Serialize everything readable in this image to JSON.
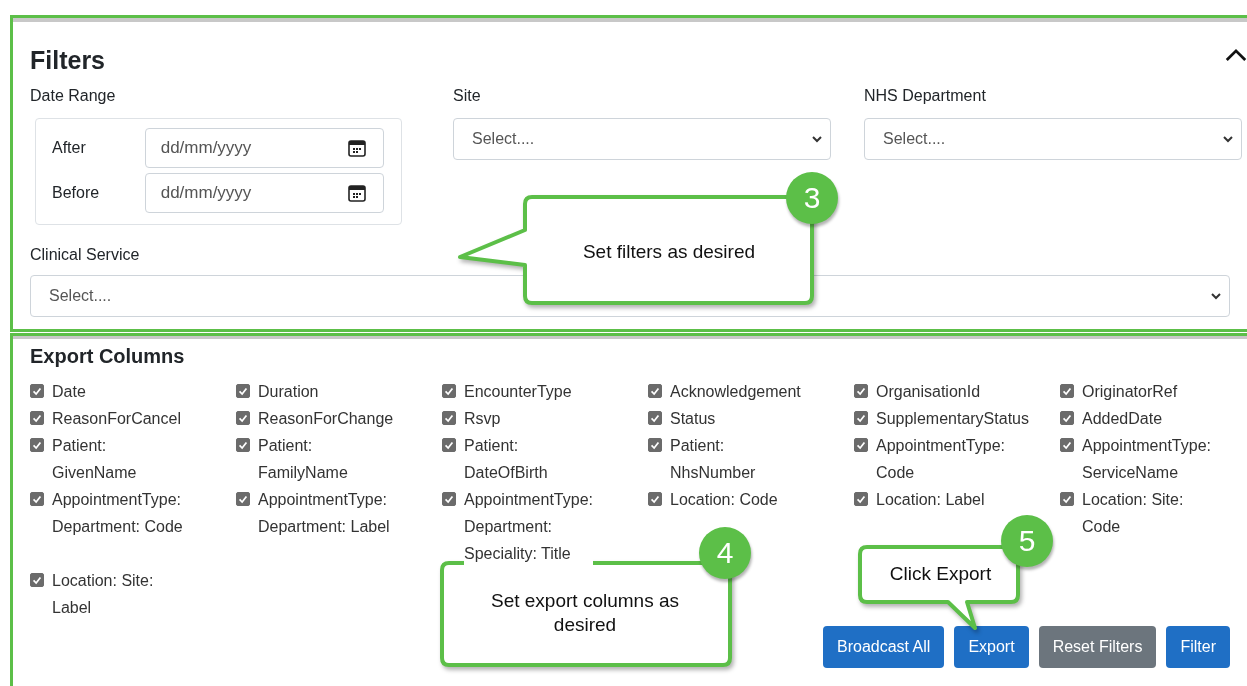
{
  "filters": {
    "title": "Filters",
    "highlighted": true,
    "date_range": {
      "label": "Date Range",
      "rows": [
        {
          "label": "After",
          "placeholder": "dd/mm/yyyy"
        },
        {
          "label": "Before",
          "placeholder": "dd/mm/yyyy"
        }
      ]
    },
    "selects": [
      {
        "label": "Site",
        "placeholder": "Select...."
      },
      {
        "label": "NHS Department",
        "placeholder": "Select...."
      },
      {
        "label": "Clinical Service",
        "placeholder": "Select...."
      }
    ]
  },
  "export_columns": {
    "title": "Export Columns",
    "highlighted": true,
    "columns": [
      {
        "label": "Date",
        "checked": true
      },
      {
        "label": "Duration",
        "checked": true
      },
      {
        "label": "EncounterType",
        "checked": true
      },
      {
        "label": "Acknowledgement",
        "checked": true
      },
      {
        "label": "OrganisationId",
        "checked": true
      },
      {
        "label": "OriginatorRef",
        "checked": true
      },
      {
        "label": "ReasonForCancel",
        "checked": true
      },
      {
        "label": "ReasonForChange",
        "checked": true
      },
      {
        "label": "Rsvp",
        "checked": true
      },
      {
        "label": "Status",
        "checked": true
      },
      {
        "label": "SupplementaryStatus",
        "checked": true
      },
      {
        "label": "AddedDate",
        "checked": true
      },
      {
        "label": "Patient:\nGivenName",
        "checked": true
      },
      {
        "label": "Patient:\nFamilyName",
        "checked": true
      },
      {
        "label": "Patient:\nDateOfBirth",
        "checked": true
      },
      {
        "label": "Patient:\nNhsNumber",
        "checked": true
      },
      {
        "label": "AppointmentType:\nCode",
        "checked": true
      },
      {
        "label": "AppointmentType:\nServiceName",
        "checked": true
      },
      {
        "label": "AppointmentType:\nDepartment: Code",
        "checked": true
      },
      {
        "label": "AppointmentType:\nDepartment: Label",
        "checked": true
      },
      {
        "label": "AppointmentType:\nDepartment:\nSpeciality: Title",
        "checked": true
      },
      {
        "label": "Location: Code",
        "checked": true
      },
      {
        "label": "Location: Label",
        "checked": true
      },
      {
        "label": "Location: Site:\nCode",
        "checked": true
      },
      {
        "label": "Location: Site:\nLabel",
        "checked": true
      }
    ]
  },
  "buttons": [
    {
      "label": "Broadcast All",
      "kind": "primary"
    },
    {
      "label": "Export",
      "kind": "primary"
    },
    {
      "label": "Reset Filters",
      "kind": "secondary"
    },
    {
      "label": "Filter",
      "kind": "primary"
    }
  ],
  "callouts": [
    {
      "number": "3",
      "text": "Set filters as desired"
    },
    {
      "number": "4",
      "text": "Set export columns as desired"
    },
    {
      "number": "5",
      "text": "Click Export"
    }
  ]
}
